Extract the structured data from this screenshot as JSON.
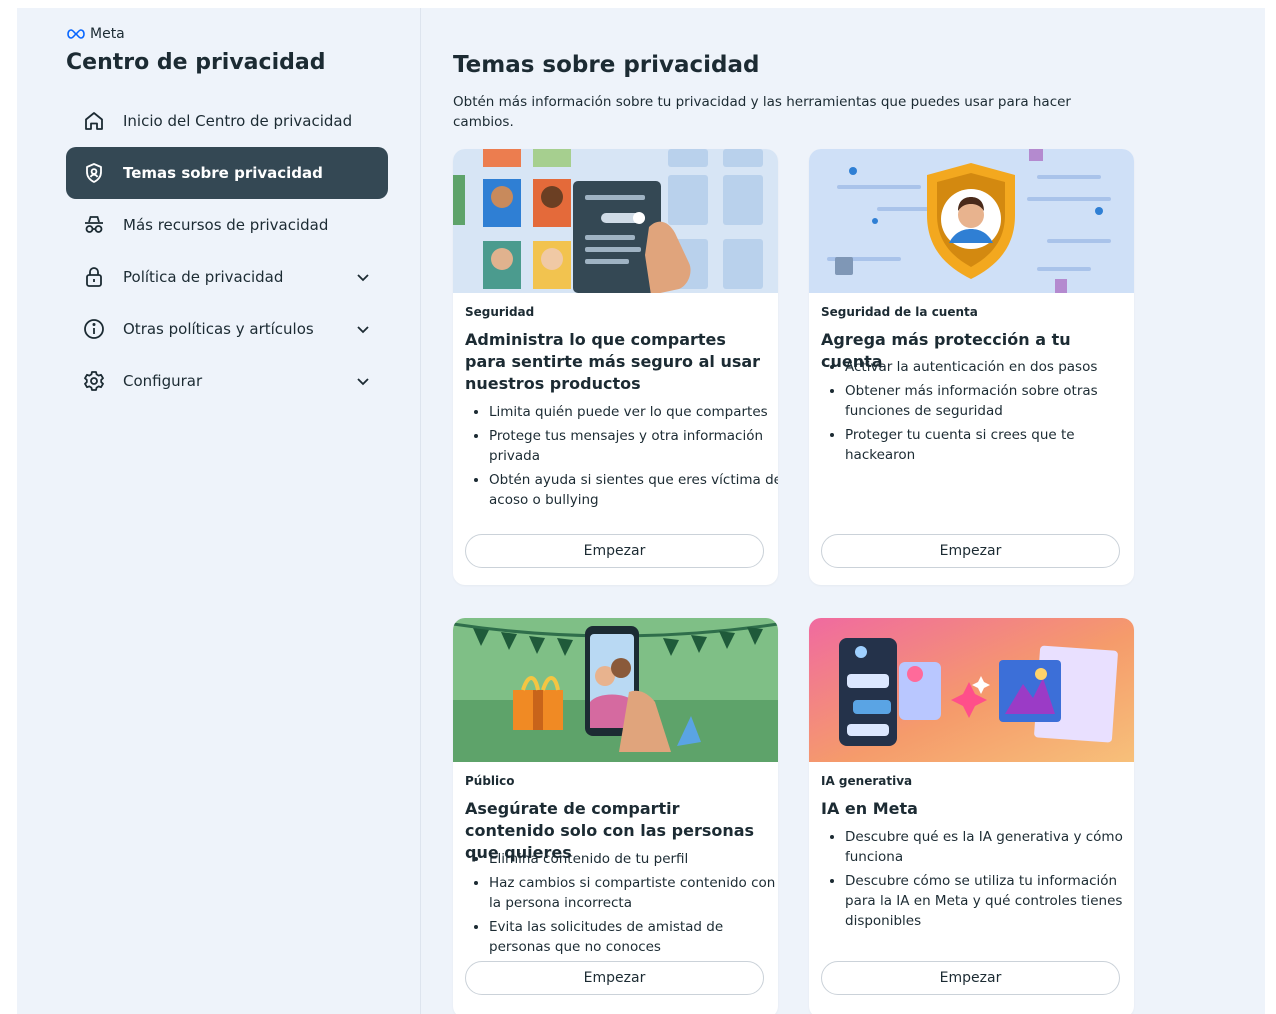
{
  "brand": {
    "name": "Meta"
  },
  "sidebar": {
    "title": "Centro de privacidad",
    "items": [
      {
        "label": "Inicio del Centro de privacidad",
        "icon": "home-icon"
      },
      {
        "label": "Temas sobre privacidad",
        "icon": "shield-icon",
        "active": true
      },
      {
        "label": "Más recursos de privacidad",
        "icon": "incognito-icon"
      },
      {
        "label": "Política de privacidad",
        "icon": "lock-icon",
        "expandable": true
      },
      {
        "label": "Otras políticas y artículos",
        "icon": "info-icon",
        "expandable": true
      },
      {
        "label": "Configurar",
        "icon": "gear-icon",
        "expandable": true
      }
    ]
  },
  "main": {
    "title": "Temas sobre privacidad",
    "description": "Obtén más información sobre tu privacidad y las herramientas que puedes usar para hacer cambios.",
    "cards": [
      {
        "category": "Seguridad",
        "title": "Administra lo que compartes para sentirte más seguro al usar nuestros productos",
        "bullets": [
          "Limita quién puede ver lo que compartes",
          "Protege tus mensajes y otra información privada",
          "Obtén ayuda si sientes que eres víctima de acoso o bullying"
        ],
        "button": "Empezar"
      },
      {
        "category": "Seguridad de la cuenta",
        "title": "Agrega más protección a tu cuenta",
        "bullets": [
          "Activar la autenticación en dos pasos",
          "Obtener más información sobre otras funciones de seguridad",
          "Proteger tu cuenta si crees que te hackearon"
        ],
        "button": "Empezar"
      },
      {
        "category": "Público",
        "title": "Asegúrate de compartir contenido solo con las personas que quieres",
        "bullets": [
          "Elimina contenido de tu perfil",
          "Haz cambios si compartiste contenido con la persona incorrecta",
          "Evita las solicitudes de amistad de personas que no conoces"
        ],
        "button": "Empezar"
      },
      {
        "category": "IA generativa",
        "title": "IA en Meta",
        "bullets": [
          "Descubre qué es la IA generativa y cómo funciona",
          "Descubre cómo se utiliza tu información para la IA en Meta y qué controles tienes disponibles"
        ],
        "button": "Empezar"
      }
    ]
  },
  "colors": {
    "page_bg": "#eef3fa",
    "active_nav_bg": "#344854",
    "text": "#1c2b33",
    "card_bg": "#ffffff"
  }
}
